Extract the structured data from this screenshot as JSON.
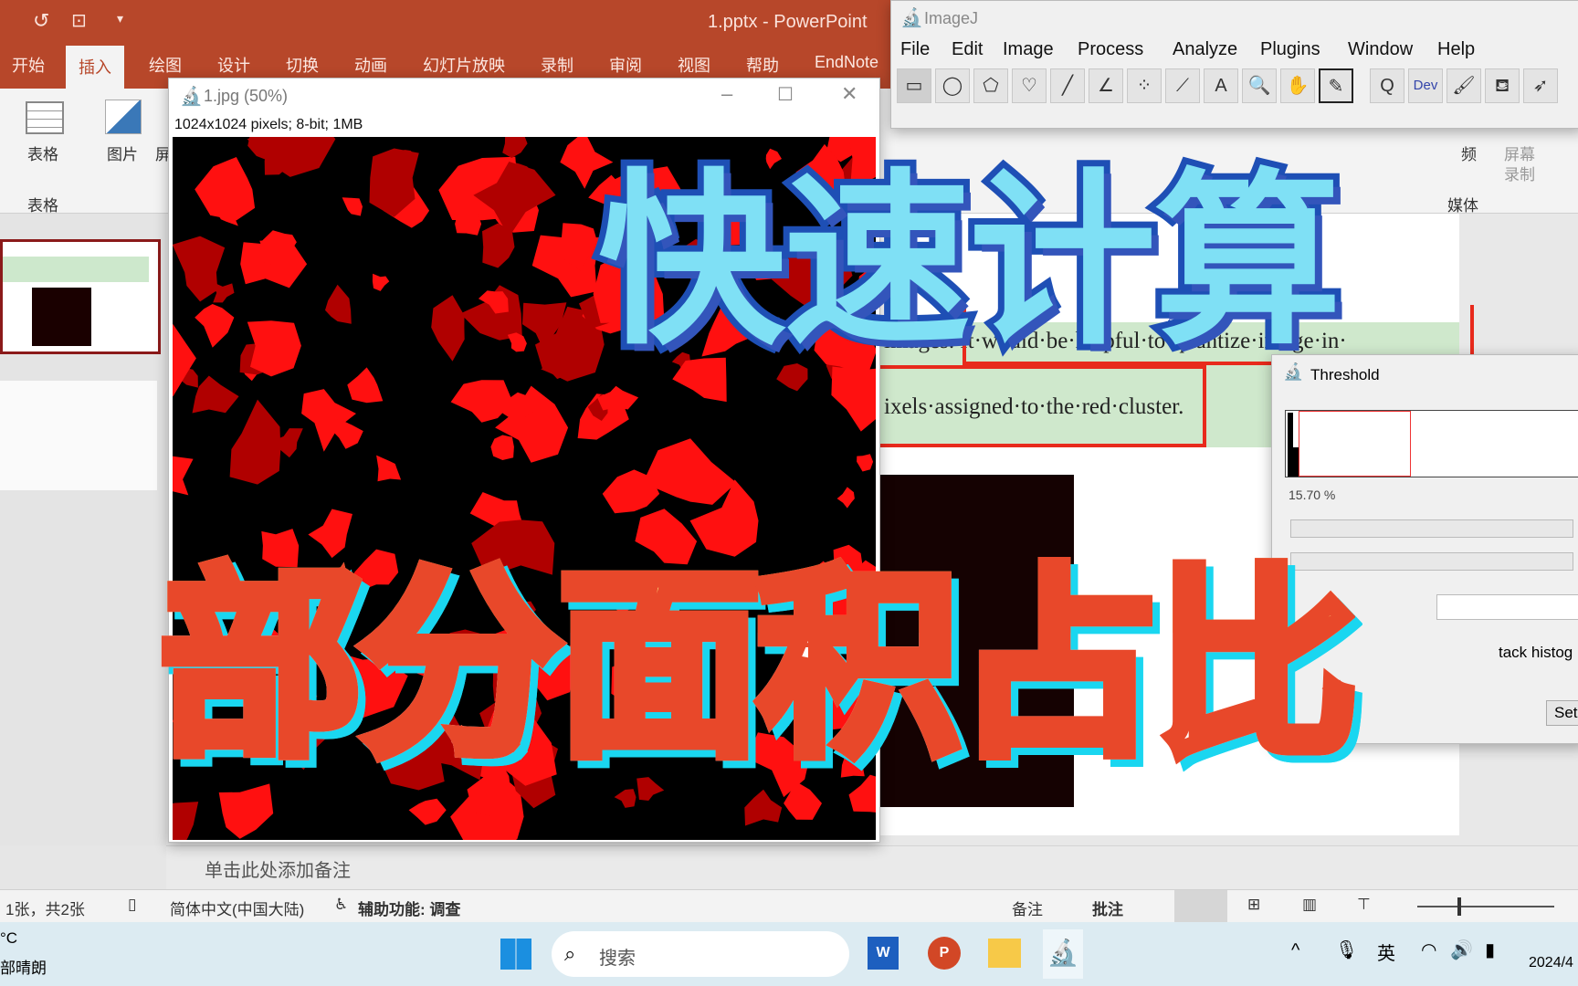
{
  "ppt": {
    "window_title": "1.pptx  -  PowerPoint",
    "tabs": [
      "开始",
      "插入",
      "绘图",
      "设计",
      "切换",
      "动画",
      "幻灯片放映",
      "录制",
      "审阅",
      "视图",
      "帮助",
      "EndNote"
    ],
    "ribbon": {
      "table": "表格",
      "picture": "图片",
      "screen_partial": "屏",
      "group_table": "表格",
      "video_partial": "频",
      "screen_record_1": "屏幕",
      "screen_record_2": "录制",
      "media_partial": "媒体"
    },
    "slide": {
      "line1": "images. It·would·be·helpful·to·quantize·image·in·",
      "line2": "ixels·assigned·to·the·red·cluster."
    },
    "notes_placeholder": "单击此处添加备注",
    "status": {
      "slide_count": "1张，共2张",
      "language": "简体中文(中国大陆)",
      "accessibility": "辅助功能: 调查",
      "notes": "备注",
      "comments": "批注"
    }
  },
  "imagej_image": {
    "title": "1.jpg (50%)",
    "info": "1024x1024 pixels; 8-bit; 1MB"
  },
  "imagej": {
    "title": "ImageJ",
    "menu": [
      "File",
      "Edit",
      "Image",
      "Process",
      "Analyze",
      "Plugins",
      "Window",
      "Help"
    ],
    "tools": [
      "▭",
      "◯",
      "⬠",
      "♡",
      "╱",
      "∠",
      "⁘",
      "⟋",
      "A",
      "🔍",
      "✋",
      "✎",
      "Q",
      "Dev",
      "🖌",
      "⛾",
      "➶"
    ]
  },
  "threshold": {
    "title": "Threshold",
    "percent": "15.70 %",
    "stack_label": "tack histog",
    "set_button": "Set"
  },
  "overlay": {
    "line1": "快速计算",
    "line2": "部分面积占比"
  },
  "taskbar": {
    "weather_temp": "°C",
    "weather_desc": "部晴朗",
    "search": "搜索",
    "ime": "英",
    "date": "2024/4"
  },
  "colors": {
    "ppt_accent": "#b7472a",
    "overlay1_fill": "#7fe0f5",
    "overlay1_stroke": "#1e4fb5",
    "overlay2_fill": "#ffffff",
    "overlay2_top": "#ffd97a",
    "overlay2_stroke": "#e8482a",
    "overlay2_shadow": "#1ad6f0"
  }
}
